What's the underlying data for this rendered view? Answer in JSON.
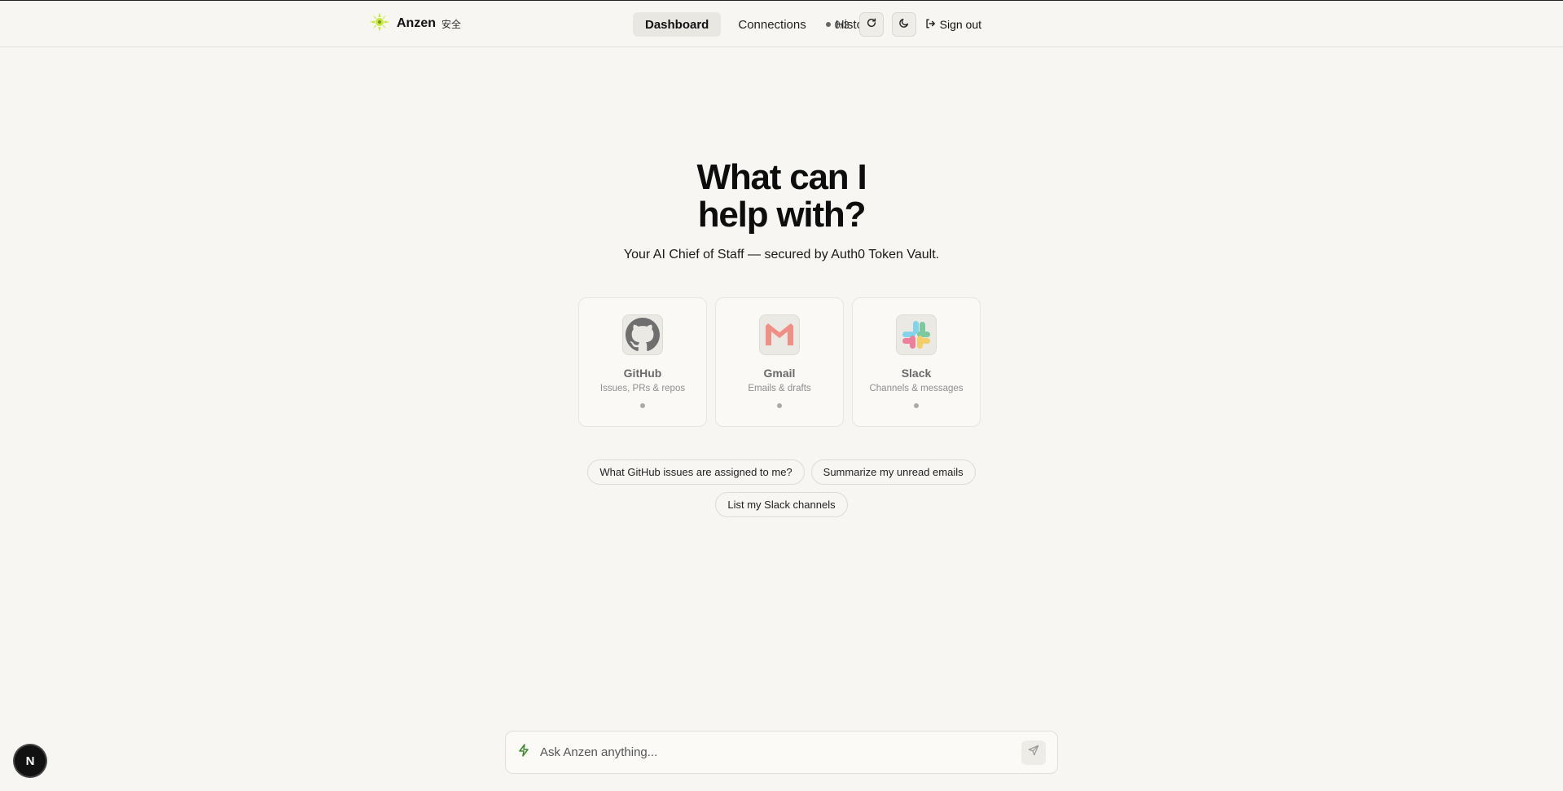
{
  "brand": {
    "name": "Anzen",
    "kanji": "安全",
    "accent": "#c6e83a"
  },
  "nav": {
    "items": [
      {
        "label": "Dashboard",
        "active": true
      },
      {
        "label": "Connections",
        "active": false
      },
      {
        "label": "History",
        "active": false
      }
    ]
  },
  "header": {
    "status": "0/3",
    "refresh_icon": "refresh-icon",
    "theme_icon": "moon-icon",
    "signout_label": "Sign out"
  },
  "hero": {
    "title_line1": "What can I",
    "title_line2": "help with?",
    "subtitle": "Your AI Chief of Staff — secured by Auth0 Token Vault."
  },
  "cards": [
    {
      "title": "GitHub",
      "desc": "Issues, PRs & repos",
      "icon": "github-icon"
    },
    {
      "title": "Gmail",
      "desc": "Emails & drafts",
      "icon": "gmail-icon"
    },
    {
      "title": "Slack",
      "desc": "Channels & messages",
      "icon": "slack-icon"
    }
  ],
  "suggestions": [
    "What GitHub issues are assigned to me?",
    "Summarize my unread emails",
    "List my Slack channels"
  ],
  "chat": {
    "placeholder": "Ask Anzen anything...",
    "accent": "#3a8a2a"
  },
  "dev_badge": "N"
}
